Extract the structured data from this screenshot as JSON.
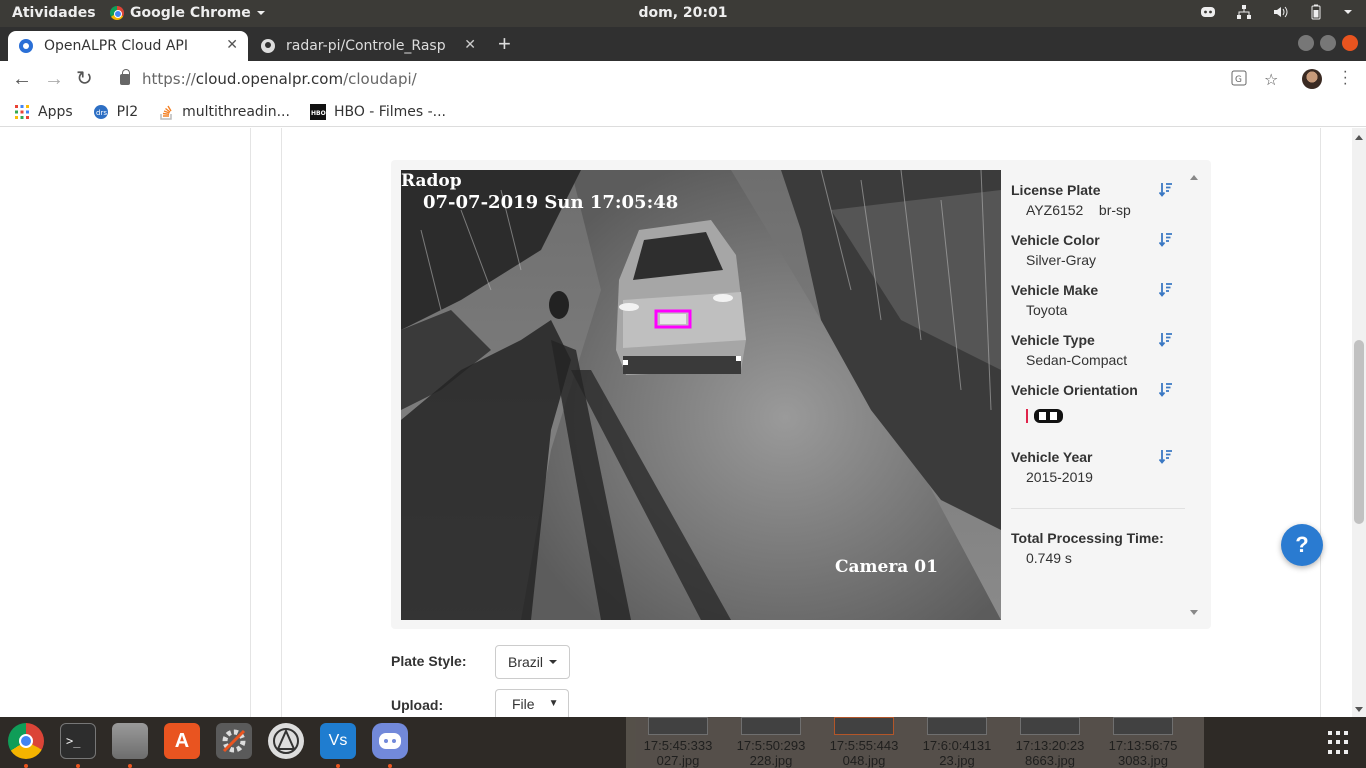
{
  "topbar": {
    "activities": "Atividades",
    "app_name": "Google Chrome",
    "clock": "dom, 20:01"
  },
  "tabs": [
    {
      "title": "OpenALPR Cloud API",
      "active": true
    },
    {
      "title": "radar-pi/Controle_Rasp",
      "active": false
    }
  ],
  "omnibox": {
    "scheme": "https://",
    "host": "cloud.openalpr.com",
    "path": "/cloudapi/"
  },
  "bookmarks": [
    {
      "label": "Apps",
      "icon": "apps-grid-icon"
    },
    {
      "label": "PI2",
      "icon": "pi2-icon"
    },
    {
      "label": "multithreadin...",
      "icon": "stackoverflow-icon"
    },
    {
      "label": "HBO - Filmes -...",
      "icon": "hbo-icon"
    }
  ],
  "camera": {
    "overlay_top": "Radop",
    "timestamp": "07-07-2019 Sun 17:05:48",
    "camera_label": "Camera 01",
    "plate_box_color": "#ff00ff"
  },
  "results": {
    "license_plate": {
      "label": "License Plate",
      "plate": "AYZ6152",
      "region": "br-sp"
    },
    "vehicle_color": {
      "label": "Vehicle Color",
      "value": "Silver-Gray"
    },
    "vehicle_make": {
      "label": "Vehicle Make",
      "value": "Toyota"
    },
    "vehicle_type": {
      "label": "Vehicle Type",
      "value": "Sedan-Compact"
    },
    "vehicle_orientation": {
      "label": "Vehicle Orientation"
    },
    "vehicle_year": {
      "label": "Vehicle Year",
      "value": "2015-2019"
    },
    "processing": {
      "label": "Total Processing Time:",
      "value": "0.749 s"
    }
  },
  "form": {
    "plate_style_label": "Plate Style:",
    "plate_style_value": "Brazil",
    "upload_label": "Upload:",
    "upload_value": "File"
  },
  "help_label": "?",
  "dock": {
    "vscode_label": "Vs",
    "thumbnails": [
      {
        "line1": "17:5:45:333",
        "line2": "027.jpg"
      },
      {
        "line1": "17:5:50:293",
        "line2": "228.jpg"
      },
      {
        "line1": "17:5:55:443",
        "line2": "048.jpg"
      },
      {
        "line1": "17:6:0:4131",
        "line2": "23.jpg"
      },
      {
        "line1": "17:13:20:23",
        "line2": "8663.jpg"
      },
      {
        "line1": "17:13:56:75",
        "line2": "3083.jpg"
      }
    ]
  },
  "colors": {
    "accent": "#2a7bd1",
    "ubuntu_orange": "#e95420",
    "sort_icon": "#3a78c3"
  }
}
